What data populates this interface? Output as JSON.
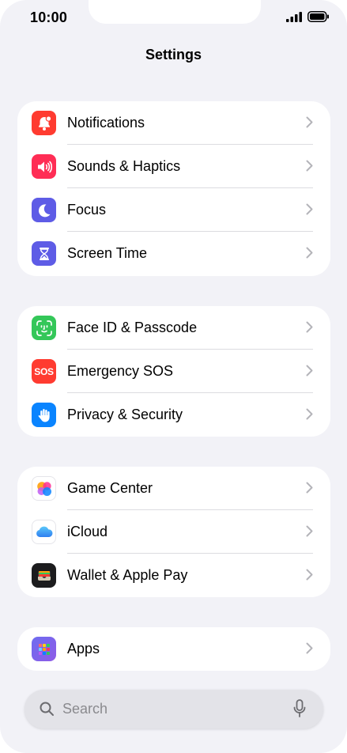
{
  "status": {
    "time": "10:00"
  },
  "header": {
    "title": "Settings"
  },
  "groups": [
    {
      "items": [
        {
          "label": "Notifications",
          "icon": "bell-badge-icon",
          "color": "#ff3b30"
        },
        {
          "label": "Sounds & Haptics",
          "icon": "speaker-wave-icon",
          "color": "#ff2d55"
        },
        {
          "label": "Focus",
          "icon": "moon-icon",
          "color": "#5e5ce6"
        },
        {
          "label": "Screen Time",
          "icon": "hourglass-icon",
          "color": "#5e5ce6"
        }
      ]
    },
    {
      "items": [
        {
          "label": "Face ID & Passcode",
          "icon": "face-id-icon",
          "color": "#34c759"
        },
        {
          "label": "Emergency SOS",
          "icon": "sos-icon",
          "color": "#ff3b30",
          "icon_text": "SOS"
        },
        {
          "label": "Privacy & Security",
          "icon": "hand-icon",
          "color": "#0a84ff"
        }
      ]
    },
    {
      "items": [
        {
          "label": "Game Center",
          "icon": "game-center-icon",
          "color": "#ffffff"
        },
        {
          "label": "iCloud",
          "icon": "cloud-icon",
          "color": "#ffffff"
        },
        {
          "label": "Wallet & Apple Pay",
          "icon": "wallet-icon",
          "color": "#1c1c1e"
        }
      ]
    },
    {
      "items": [
        {
          "label": "Apps",
          "icon": "apps-grid-icon",
          "color": "#5e5ce6"
        }
      ]
    }
  ],
  "search": {
    "placeholder": "Search"
  }
}
